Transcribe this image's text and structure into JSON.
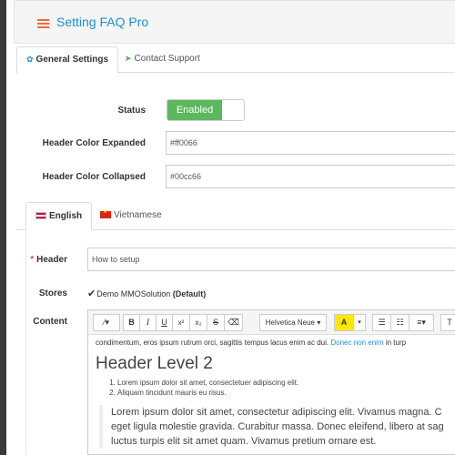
{
  "header": {
    "title": "Setting FAQ Pro",
    "icon": "list-icon"
  },
  "tabs": [
    {
      "label": "General Settings",
      "icon": "gear-icon"
    },
    {
      "label": "Contact Support",
      "icon": "paper-plane-icon"
    }
  ],
  "form": {
    "status_label": "Status",
    "status_value": "Enabled",
    "color_expanded_label": "Header Color Expanded",
    "color_expanded_value": "#ff0066",
    "color_collapsed_label": "Header Color Collapsed",
    "color_collapsed_value": "#00cc66"
  },
  "languages": [
    {
      "label": "English",
      "flag": "uk-flag-icon"
    },
    {
      "label": "Vietnamese",
      "flag": "vn-flag-icon"
    }
  ],
  "lang_form": {
    "header_label": "Header",
    "header_value": "How to setup",
    "stores_label": "Stores",
    "store_name": "Demo MMOSolution",
    "store_default": "(Default)",
    "content_label": "Content"
  },
  "toolbar": {
    "font_name": "Helvetica Neue",
    "bold": "B",
    "italic": "I",
    "underline": "U",
    "superscript": "x²",
    "subscript": "x₂",
    "strikethrough": "S",
    "text_color": "A",
    "more": "T"
  },
  "editor": {
    "line1": "condimentum, eros ipsum rutrum orci, sagittis tempus lacus enim ac dui.",
    "line1_link": "Donec non enim",
    "line1_tail": "in turp",
    "heading": "Header Level 2",
    "list": [
      "Lorem ipsum dolor sit amet, consectetuer adipiscing elit.",
      "Aliquam tincidunt mauris eu risus."
    ],
    "quote": [
      "Lorem ipsum dolor sit amet, consectetur adipiscing elit. Vivamus magna. C",
      "eget ligula molestie gravida. Curabitur massa. Donec eleifend, libero at sag",
      "luctus turpis elit sit amet quam. Vivamus pretium ornare est."
    ]
  }
}
